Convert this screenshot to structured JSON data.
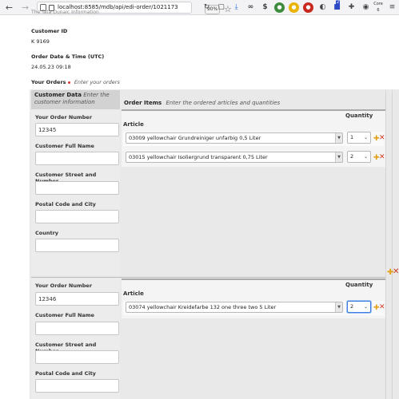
{
  "browser": {
    "url": "localhost:8585/mdb/api/edi-order/1021173",
    "zoom": "90%",
    "toolbar_badge": "2",
    "toolbar_text": "Core 6",
    "icons": [
      "back-icon",
      "forward-icon",
      "page-icon",
      "star-icon",
      "reload-icon",
      "download-icon",
      "infinity-icon",
      "dollar-icon",
      "extension-icon"
    ]
  },
  "page": {
    "cut_text": "The Tata Dunaic Information",
    "customer_id_label": "Customer ID",
    "customer_id_value": "K 9169",
    "order_date_label": "Order Date & Time (UTC)",
    "order_date_value": "24.05.23 09:18",
    "your_orders_label": "Your Orders",
    "your_orders_hint": "Enter your orders",
    "customer_data_label": "Customer Data",
    "customer_data_hint": "Enter the customer information",
    "order_items_label": "Order Items",
    "order_items_hint": "Enter the ordered articles and quantities"
  },
  "orders": [
    {
      "fields": {
        "order_number_label": "Your Order Number",
        "order_number_value": "12345",
        "full_name_label": "Customer Full Name",
        "full_name_value": "",
        "street_label": "Customer Street and Number",
        "street_value": "",
        "postal_label": "Postal Code and City",
        "postal_value": "",
        "country_label": "Country",
        "country_value": ""
      },
      "article_header": "Article",
      "quantity_header": "Quantity",
      "items": [
        {
          "article": "03009 yellowchair Grundreiniger unfarbig 0,5 Liter",
          "quantity": "1"
        },
        {
          "article": "03015 yellowchair Isoliergrund transparent 0,75 Liter",
          "quantity": "2"
        }
      ]
    },
    {
      "fields": {
        "order_number_label": "Your Order Number",
        "order_number_value": "12346",
        "full_name_label": "Customer Full Name",
        "full_name_value": "",
        "street_label": "Customer Street and Number",
        "street_value": "",
        "postal_label": "Postal Code and City",
        "postal_value": ""
      },
      "article_header": "Article",
      "quantity_header": "Quantity",
      "items": [
        {
          "article": "03074 yellowchair Kreidefarbe 132 one three two 5 Liter",
          "quantity": "2"
        }
      ]
    }
  ],
  "colors": {
    "add_icon": "#e2a21c",
    "remove_icon": "#d23a22",
    "required_dot": "#dd3333",
    "focus_border": "#3b7de0"
  }
}
